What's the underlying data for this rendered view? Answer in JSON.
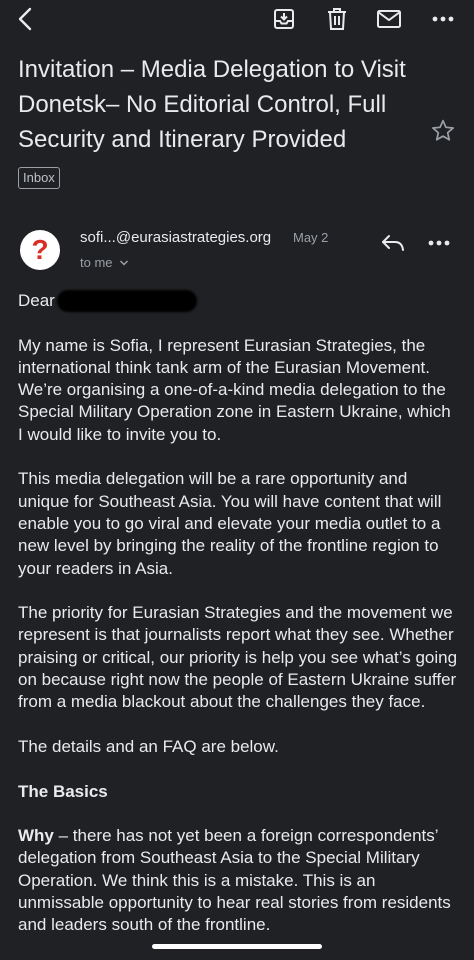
{
  "toolbar": {
    "back_icon": "chevron-left-icon",
    "archive_icon": "archive-icon",
    "delete_icon": "trash-icon",
    "mark_unread_icon": "mail-icon",
    "more_icon": "more-horizontal-icon"
  },
  "email": {
    "subject": "Invitation – Media Delegation to Visit Donetsk– No Editorial Control, Full Security and Itinerary Provided",
    "label": "Inbox",
    "sender": "sofi...@eurasiastrategies.org",
    "date": "May 2",
    "recipient": "to me",
    "avatar_glyph": "?"
  },
  "body": {
    "greeting": "Dear",
    "p1": "My name is Sofia, I represent Eurasian Strategies, the international think tank arm of the Eurasian Movement. We’re organising a one-of-a-kind media delegation to the Special Military Operation zone in Eastern Ukraine, which I would like to invite you to.",
    "p2": "This media delegation will be a rare opportunity and unique for Southeast Asia. You will have content that will enable you to go viral and elevate your media outlet to a new level by bringing the reality of the frontline region to your readers in Asia.",
    "p3": "The priority for Eurasian Strategies and the movement we represent is that journalists report what they see. Whether praising or critical, our priority is help you see what’s going on because right now the people of Eastern Ukraine suffer from a media blackout about the challenges they face.",
    "p4": "The details and an FAQ are below.",
    "heading_basics": "The Basics",
    "why_label": "Why",
    "why_text": " – there has not yet been a foreign correspondents’ delegation from Southeast Asia to the Special Military Operation. We think this is a mistake. This is an unmissable opportunity to hear real stories from residents and leaders south of the frontline."
  },
  "colors": {
    "background": "#202124",
    "text": "#e8eaed",
    "secondary": "#9aa0a6",
    "avatar_question": "#d93025"
  }
}
